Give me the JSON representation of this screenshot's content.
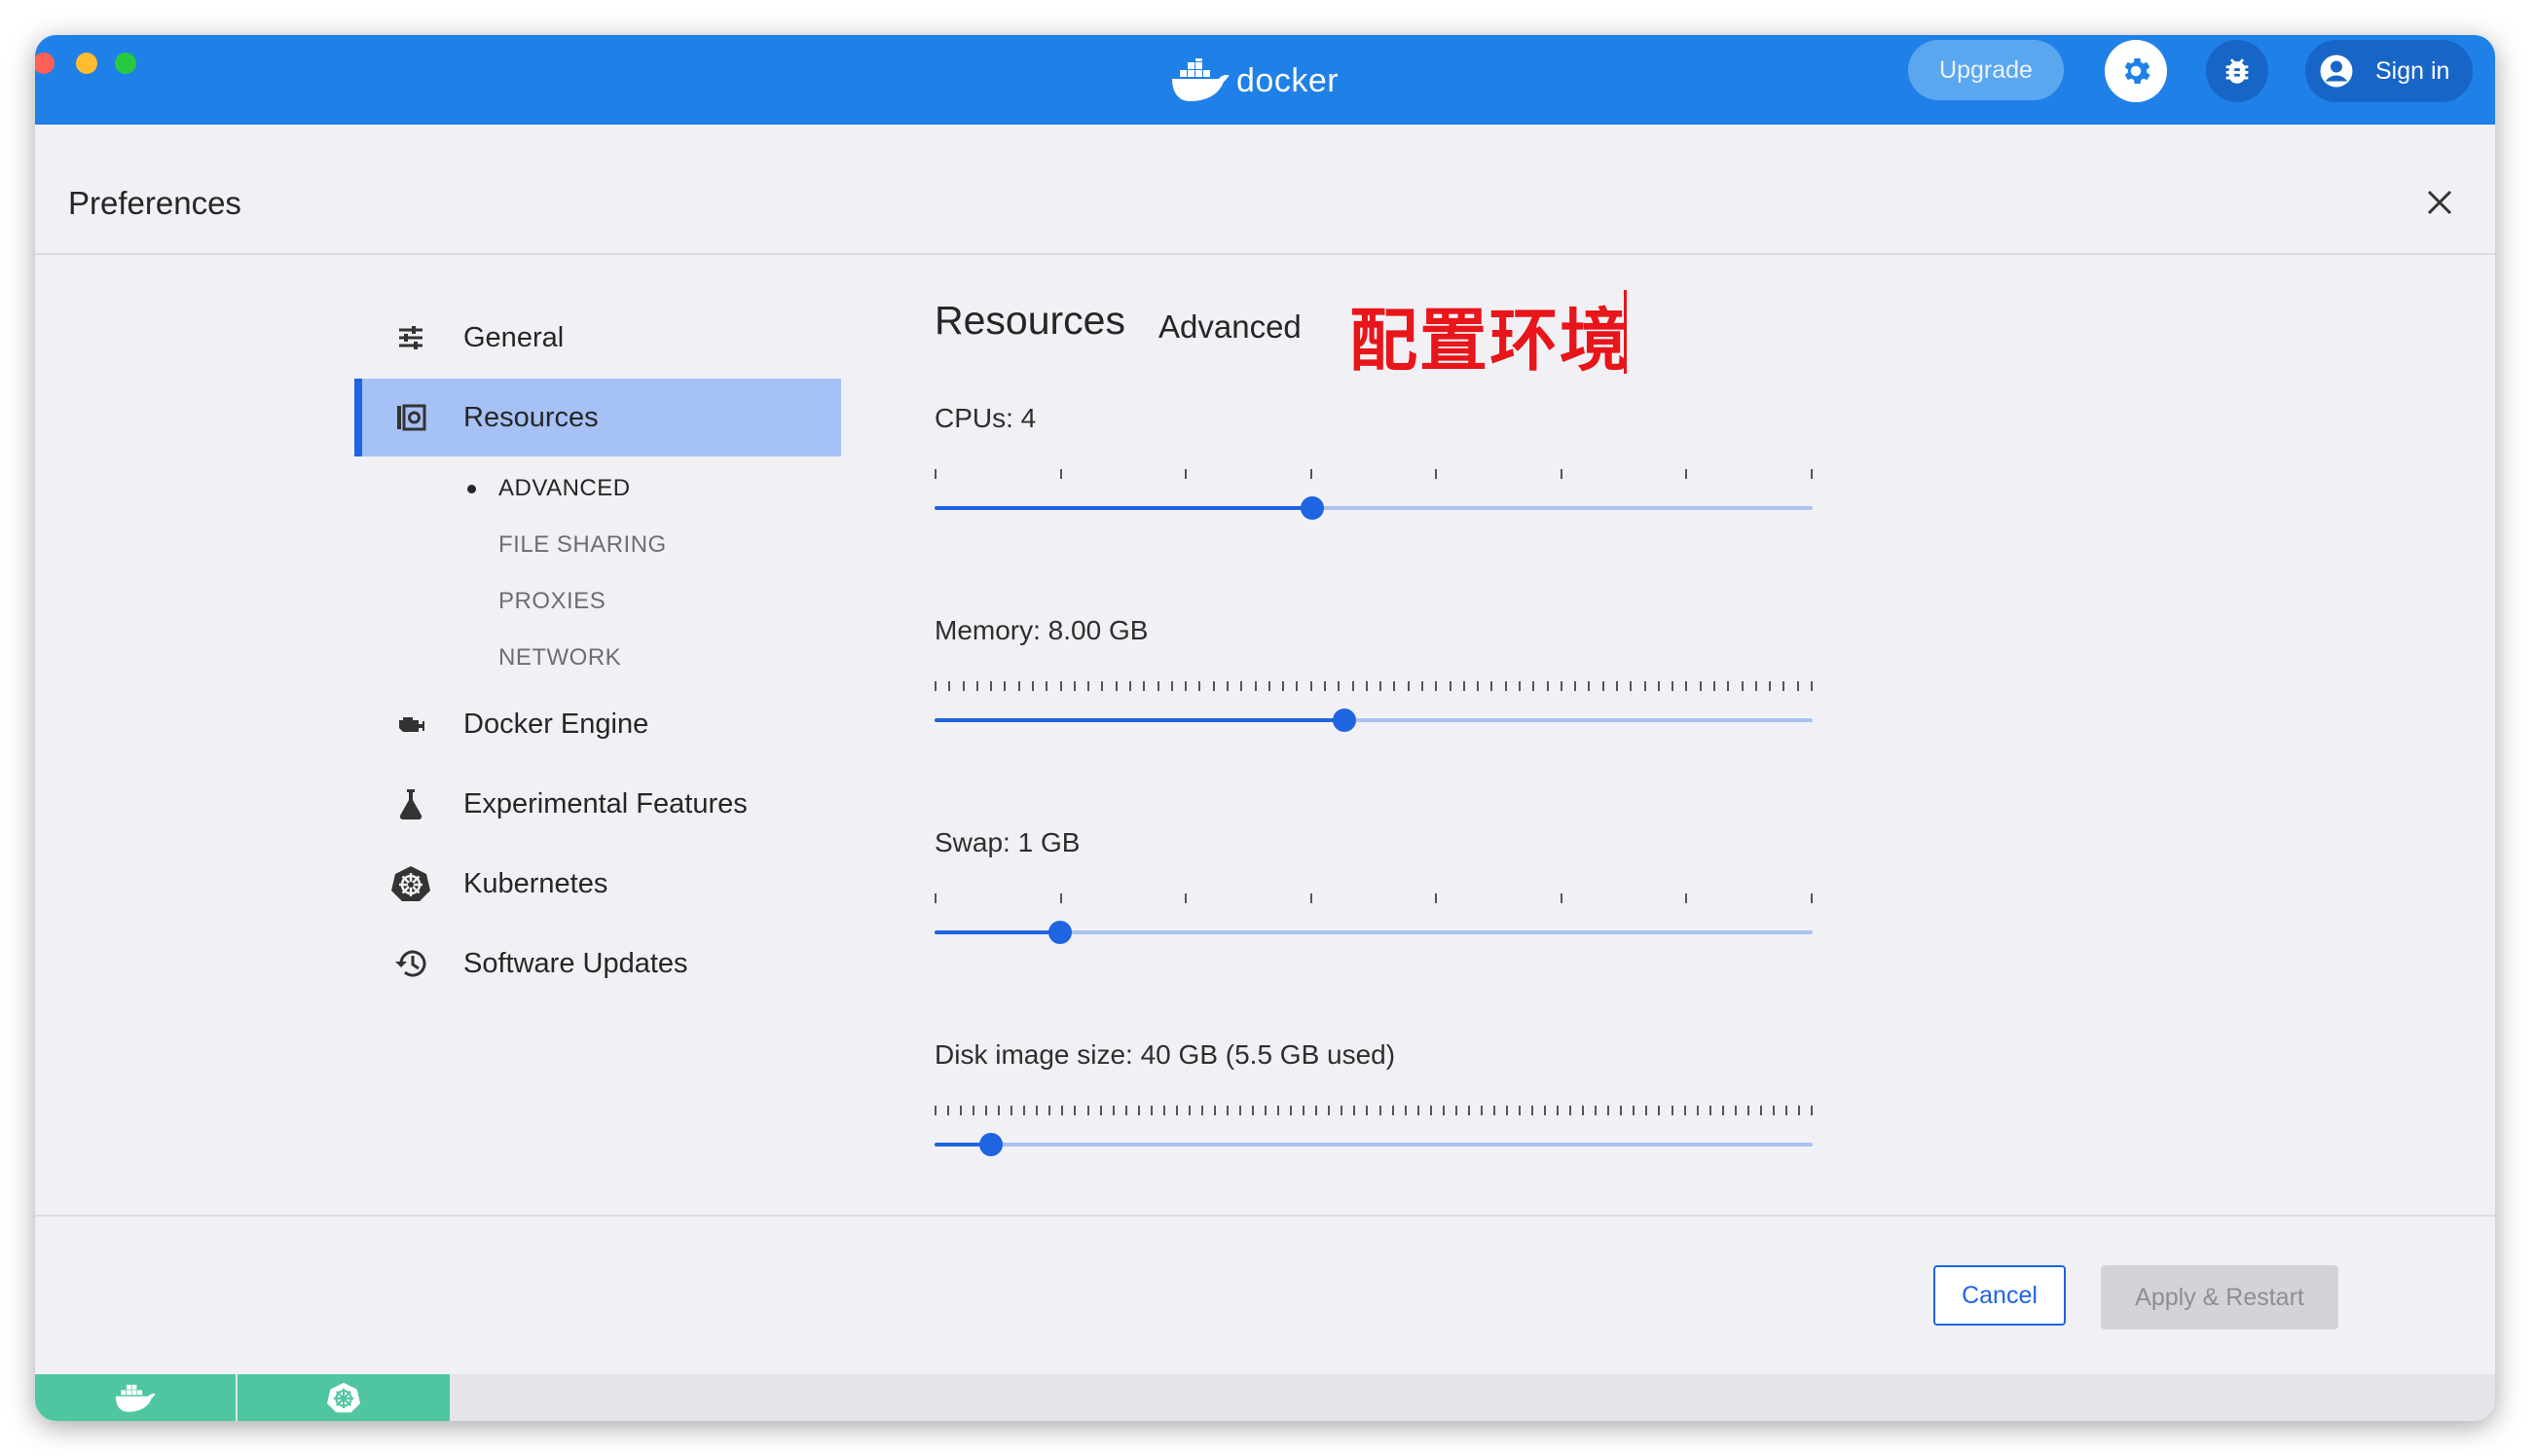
{
  "app": {
    "logo_text": "docker",
    "upgrade_label": "Upgrade",
    "signin_label": "Sign in",
    "accent": "#1f80e8"
  },
  "preferences": {
    "title": "Preferences"
  },
  "nav": {
    "items": [
      {
        "label": "General",
        "icon": "sliders-icon"
      },
      {
        "label": "Resources",
        "icon": "resources-icon",
        "active": true
      },
      {
        "label": "Docker Engine",
        "icon": "engine-icon"
      },
      {
        "label": "Experimental Features",
        "icon": "flask-icon"
      },
      {
        "label": "Kubernetes",
        "icon": "kubernetes-icon"
      },
      {
        "label": "Software Updates",
        "icon": "history-icon"
      }
    ],
    "sub_items": [
      "ADVANCED",
      "FILE SHARING",
      "PROXIES",
      "NETWORK"
    ],
    "active_sub_item": "ADVANCED"
  },
  "content": {
    "heading": "Resources",
    "tab_advanced": "Advanced",
    "annotation": "配置环境"
  },
  "sliders": {
    "cpus": {
      "label": "CPUs: 4",
      "fraction": 0.43,
      "ticks": 8
    },
    "memory": {
      "label": "Memory: 8.00 GB",
      "fraction": 0.467,
      "ticks": 64
    },
    "swap": {
      "label": "Swap: 1 GB",
      "fraction": 0.143,
      "ticks": 8
    },
    "disk": {
      "label": "Disk image size: 40 GB (5.5 GB used)",
      "fraction": 0.064,
      "ticks": 70
    }
  },
  "footer": {
    "cancel_label": "Cancel",
    "apply_label": "Apply & Restart"
  },
  "statusbar": {
    "items": [
      "docker-status-icon",
      "kubernetes-status-icon"
    ],
    "status_color": "#4fc6a1"
  }
}
